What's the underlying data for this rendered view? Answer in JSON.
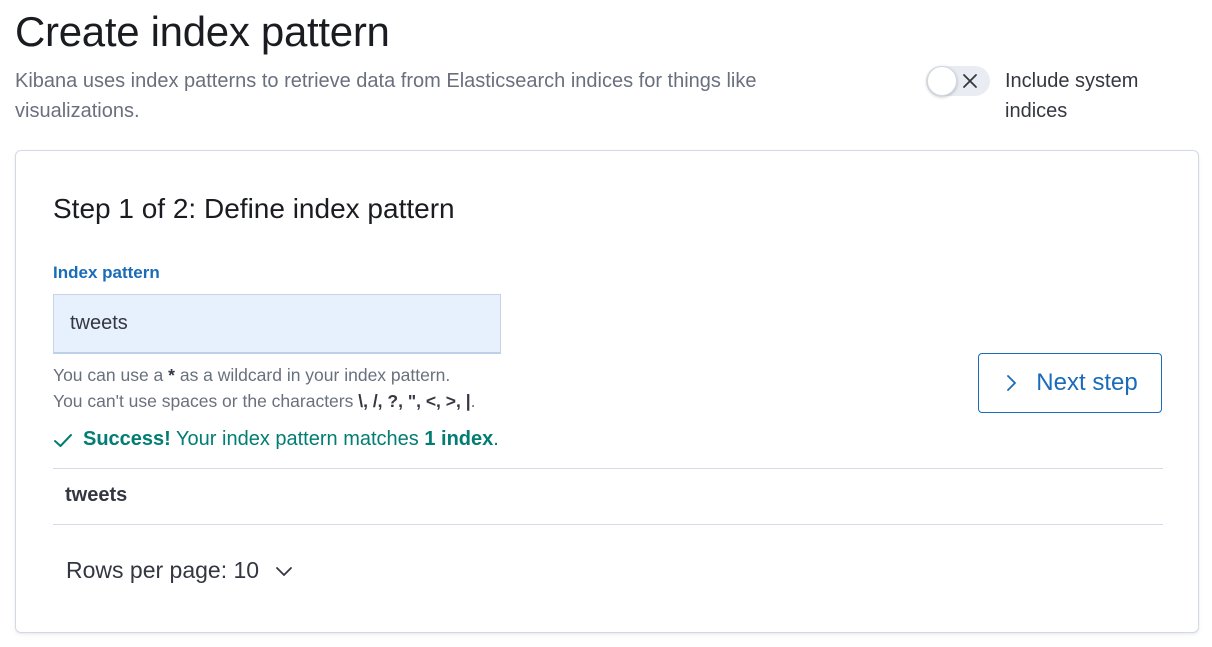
{
  "header": {
    "title": "Create index pattern",
    "description": "Kibana uses index patterns to retrieve data from Elasticsearch indices for things like visualizations."
  },
  "system_toggle": {
    "label": "Include system indices",
    "checked": false
  },
  "step": {
    "title": "Step 1 of 2: Define index pattern",
    "field_label": "Index pattern",
    "field_value": "tweets",
    "help_line_1_prefix": "You can use a ",
    "help_line_1_bold": "*",
    "help_line_1_suffix": " as a wildcard in your index pattern.",
    "help_line_2_prefix": "You can't use spaces or the characters ",
    "help_line_2_chars": "\\, /, ?, \", <, >, |",
    "help_line_2_suffix": ".",
    "success_label": "Success!",
    "success_text": " Your index pattern matches ",
    "success_count": "1 index",
    "success_end": ".",
    "next_button": "Next step"
  },
  "results": {
    "indices": [
      "tweets"
    ],
    "rows_per_page_label": "Rows per page: 10"
  },
  "colors": {
    "accent": "#1a6bb8",
    "success": "#017d73",
    "input_bg": "#e7f0fd"
  }
}
